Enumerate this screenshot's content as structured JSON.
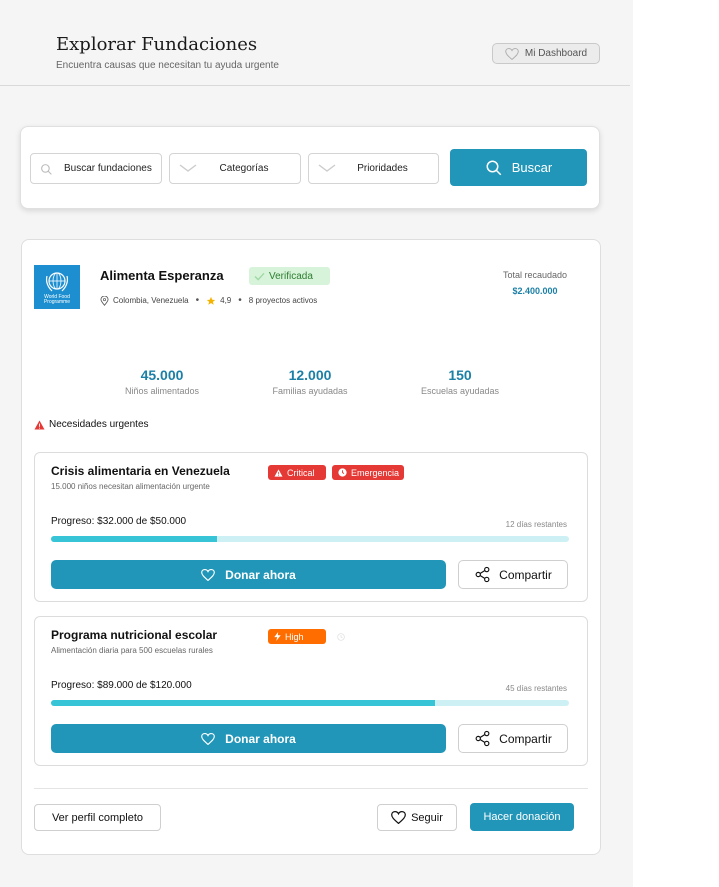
{
  "header": {
    "title": "Explorar Fundaciones",
    "subtitle": "Encuentra causas que necesitan tu ayuda urgente",
    "dashboard_label": "Mi Dashboard"
  },
  "search": {
    "placeholder": "Buscar fundaciones",
    "category_label": "Categorías",
    "priority_label": "Prioridades",
    "button_label": "Buscar"
  },
  "foundation": {
    "name": "Alimenta Esperanza",
    "verified_label": "Verificada",
    "logo_text": "World Food Programme",
    "location": "Colombia, Venezuela",
    "rating": "4,9",
    "projects": "8 proyectos activos",
    "total_label": "Total recaudado",
    "total_value": "$2.400.000",
    "stats": [
      {
        "value": "45.000",
        "label": "Niños alimentados"
      },
      {
        "value": "12.000",
        "label": "Familias ayudadas"
      },
      {
        "value": "150",
        "label": "Escuelas ayudadas"
      }
    ],
    "urgent_heading": "Necesidades urgentes",
    "needs": [
      {
        "title": "Crisis alimentaria en Venezuela",
        "description": "15.000 niños necesitan alimentación urgente",
        "tags": [
          "Critical",
          "Emergencia"
        ],
        "progress_label": "Progreso: $32.000 de $50.000",
        "progress_fraction": 0.32,
        "days_left": "12 días restantes",
        "donate_label": "Donar ahora",
        "share_label": "Compartir"
      },
      {
        "title": "Programa nutricional escolar",
        "description": "Alimentación diaria para 500 escuelas rurales",
        "tags": [
          "High"
        ],
        "progress_label": "Progreso: $89.000 de $120.000",
        "progress_fraction": 0.7417,
        "days_left": "45 días restantes",
        "donate_label": "Donar ahora",
        "share_label": "Compartir"
      }
    ],
    "profile_label": "Ver perfil completo",
    "follow_label": "Seguir",
    "donate_label": "Hacer donación"
  },
  "colors": {
    "primary": "#2196b8",
    "critical": "#e53935",
    "high": "#ff6d00",
    "progress_fill": "#36c4d6",
    "progress_track": "#cdf0f5",
    "verified_bg": "#d7f3d9"
  },
  "icons": [
    "heart-icon",
    "search-icon",
    "chevron-down-icon",
    "check-icon",
    "location-pin-icon",
    "star-icon",
    "warning-icon",
    "clock-icon",
    "bolt-icon",
    "share-icon"
  ]
}
